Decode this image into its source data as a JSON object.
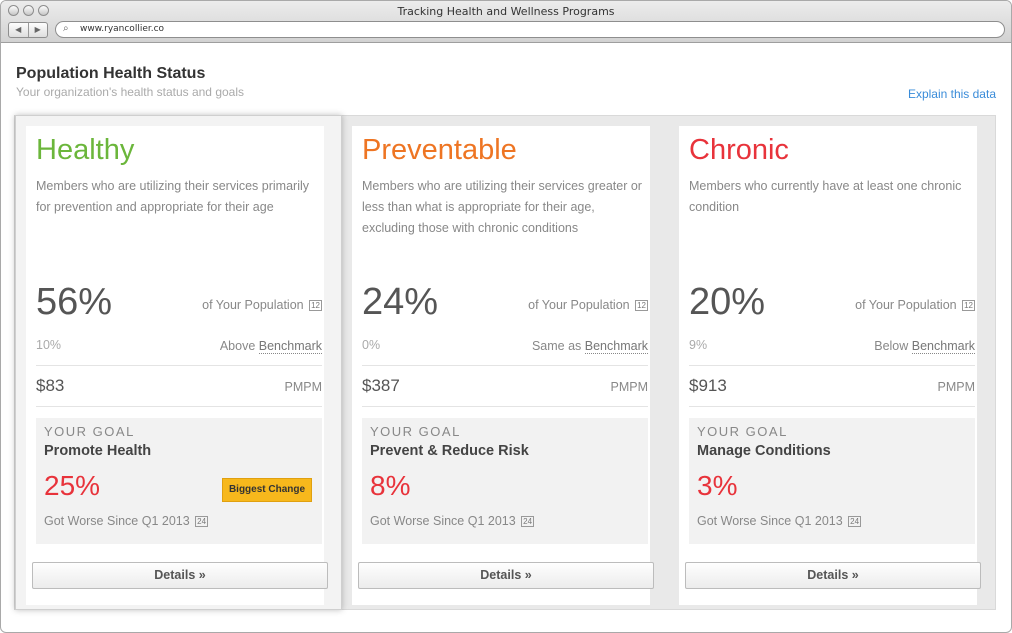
{
  "window": {
    "title": "Tracking Health and Wellness Programs",
    "url": "www.ryancollier.co",
    "back_glyph": "◀",
    "forward_glyph": "▶",
    "url_icon_glyph": "⌕"
  },
  "header": {
    "title": "Population Health Status",
    "subtitle": "Your organization's health status and goals",
    "explain_link": "Explain this data"
  },
  "colors": {
    "healthy": "#6bb63b",
    "preventable": "#ee7523",
    "chronic": "#e8333b",
    "link": "#3a8cd9",
    "badge": "#f7b81c"
  },
  "calendar_icon_text": "12",
  "goal_calendar_icon_text": "24",
  "cards": [
    {
      "title": "Healthy",
      "description": "Members who are utilizing their services primarily for prevention and appropriate for their age",
      "percent": "56%",
      "population_label": "of Your Population",
      "benchmark_value": "10%",
      "benchmark_prefix": "Above",
      "benchmark_link": "Benchmark",
      "pmpm_value": "$83",
      "pmpm_label": "PMPM",
      "goal_kicker": "YOUR GOAL",
      "goal_name": "Promote Health",
      "goal_percent": "25%",
      "goal_status": "Got Worse Since Q1 2013",
      "badge": "Biggest Change",
      "details": "Details »"
    },
    {
      "title": "Preventable",
      "description": "Members who are utilizing their services greater or less than what is appropriate for their age, excluding those with chronic conditions",
      "percent": "24%",
      "population_label": "of Your Population",
      "benchmark_value": "0%",
      "benchmark_prefix": "Same as",
      "benchmark_link": "Benchmark",
      "pmpm_value": "$387",
      "pmpm_label": "PMPM",
      "goal_kicker": "YOUR GOAL",
      "goal_name": "Prevent & Reduce Risk",
      "goal_percent": "8%",
      "goal_status": "Got Worse Since Q1 2013",
      "details": "Details »"
    },
    {
      "title": "Chronic",
      "description": "Members who currently have at least one chronic condition",
      "percent": "20%",
      "population_label": "of Your Population",
      "benchmark_value": "9%",
      "benchmark_prefix": "Below",
      "benchmark_link": "Benchmark",
      "pmpm_value": "$913",
      "pmpm_label": "PMPM",
      "goal_kicker": "YOUR GOAL",
      "goal_name": "Manage Conditions",
      "goal_percent": "3%",
      "goal_status": "Got Worse Since Q1 2013",
      "details": "Details »"
    }
  ]
}
